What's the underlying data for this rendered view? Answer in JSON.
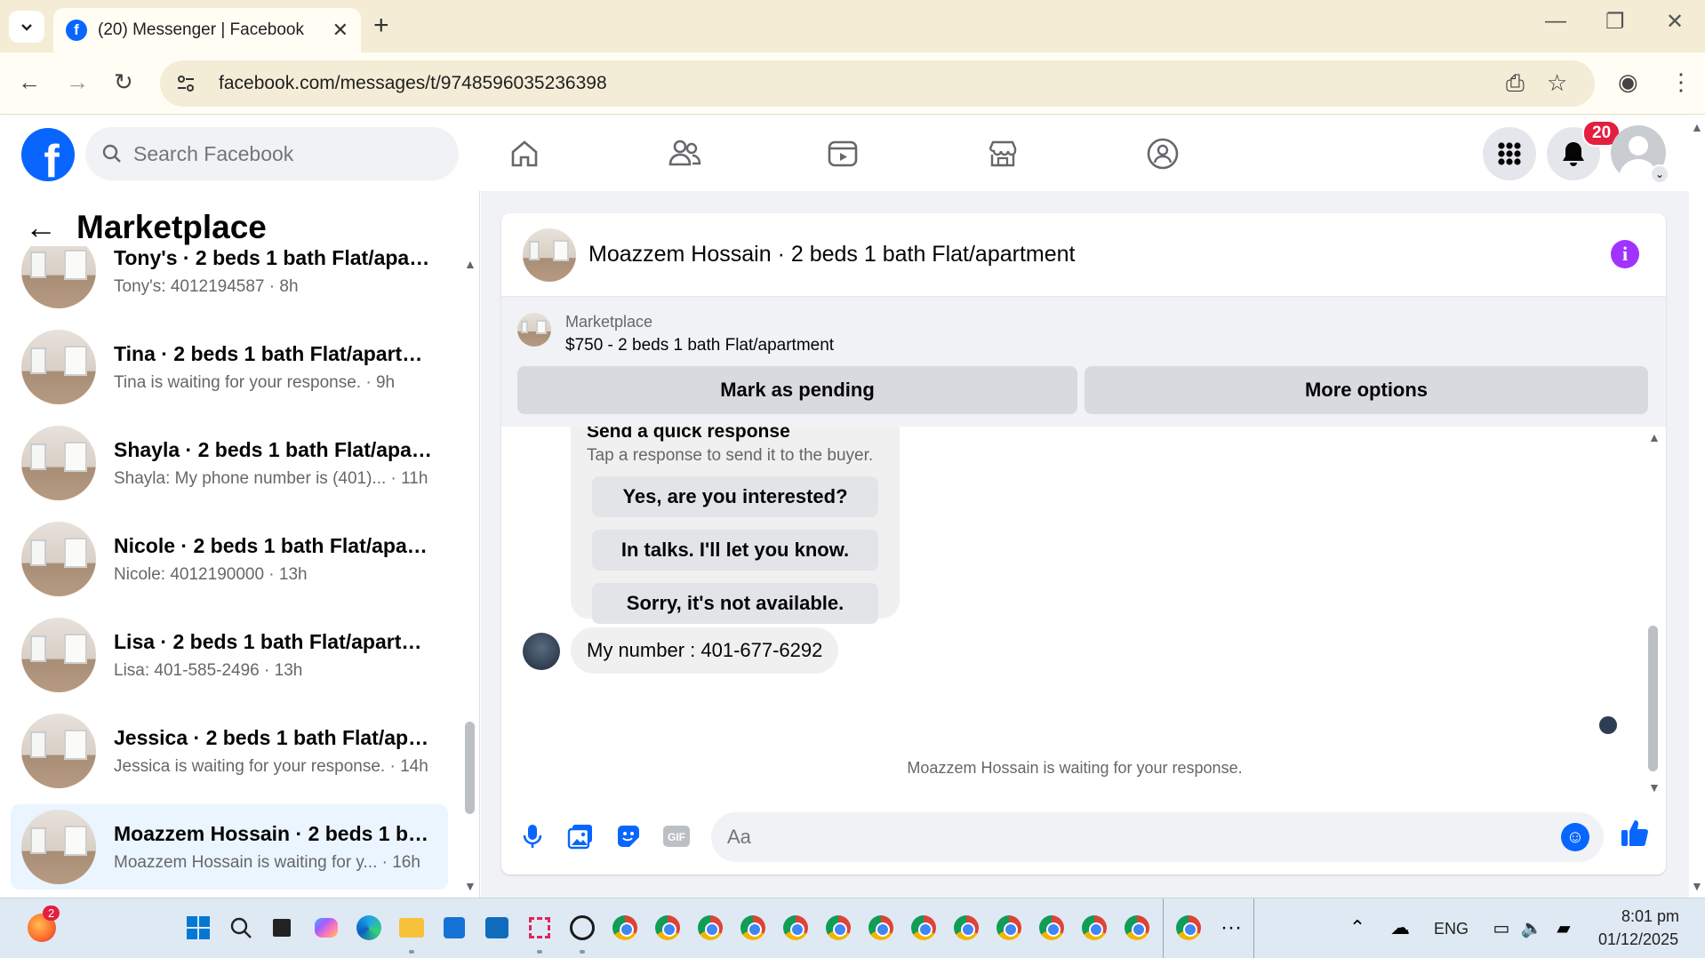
{
  "browser": {
    "tab_title": "(20) Messenger | Facebook",
    "url": "facebook.com/messages/t/9748596035236398"
  },
  "header": {
    "search_placeholder": "Search Facebook",
    "notification_count": "20",
    "icons": [
      "home-icon",
      "friends-icon",
      "video-icon",
      "marketplace-icon",
      "groups-icon",
      "menu-grid-icon",
      "bell-icon"
    ]
  },
  "sidebar": {
    "title": "Marketplace",
    "conversations": [
      {
        "name": "Tony's · 2 beds 1 bath Flat/apart...",
        "sub": "Tony's: 4012194587 · 8h"
      },
      {
        "name": "Tina · 2 beds 1 bath Flat/apartm...",
        "sub": "Tina is waiting for your response. · 9h"
      },
      {
        "name": "Shayla · 2 beds 1 bath Flat/apart...",
        "sub": "Shayla: My phone number is (401)... · 11h"
      },
      {
        "name": "Nicole · 2 beds 1 bath Flat/apart...",
        "sub": "Nicole: 4012190000 · 13h"
      },
      {
        "name": "Lisa · 2 beds 1 bath Flat/apartme...",
        "sub": "Lisa: 401-585-2496 · 13h"
      },
      {
        "name": "Jessica · 2 beds 1 bath Flat/apart...",
        "sub": "Jessica is waiting for your response. · 14h"
      },
      {
        "name": "Moazzem Hossain · 2 beds 1 bat...",
        "sub": "Moazzem Hossain is waiting for y... · 16h"
      }
    ]
  },
  "conversation": {
    "title": "Moazzem Hossain · 2 beds 1 bath Flat/apartment",
    "listing_label": "Marketplace",
    "listing_price": "$750 - 2 beds 1 bath Flat/apartment",
    "mark_pending": "Mark as pending",
    "more_options": "More options",
    "quick_response_title": "Send a quick response",
    "quick_response_sub": "Tap a response to send it to the buyer.",
    "quick_responses": [
      "Yes, are you interested?",
      "In talks. I'll let you know.",
      "Sorry, it's not available."
    ],
    "message": "My number : 401-677-6292",
    "waiting_text": "Moazzem Hossain is waiting for your response.",
    "composer_placeholder": "Aa"
  },
  "taskbar": {
    "app_badge": "2",
    "language": "ENG",
    "time": "8:01 pm",
    "date": "01/12/2025"
  },
  "colors": {
    "facebook_blue": "#0866ff",
    "notification_red": "#e41e3f",
    "info_purple": "#a033ff"
  }
}
